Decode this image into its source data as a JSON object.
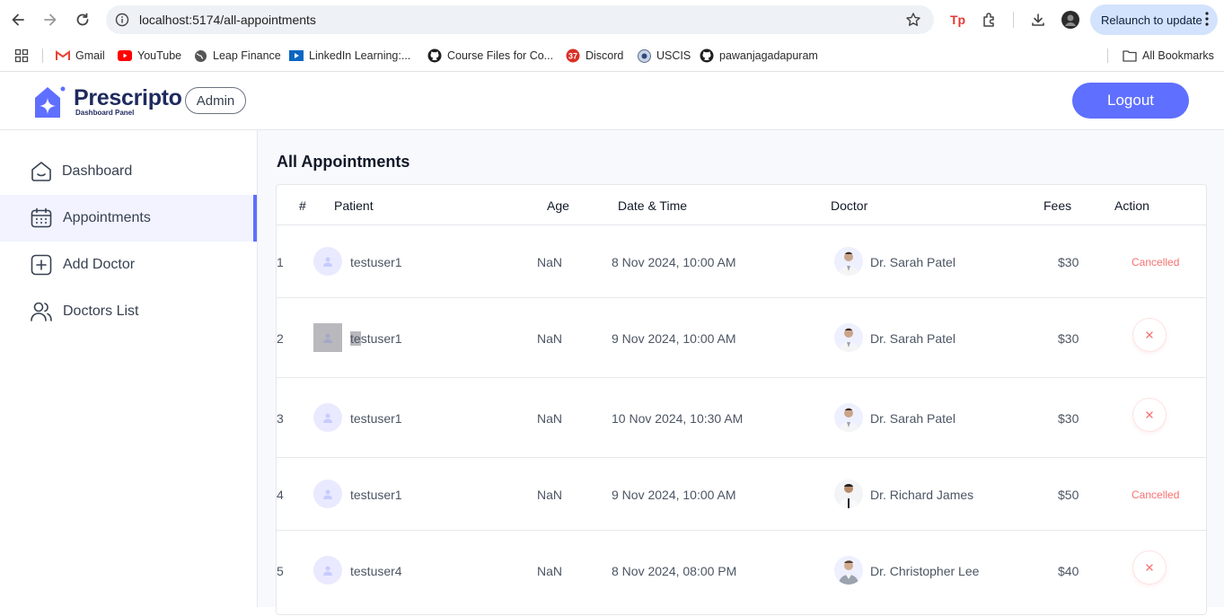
{
  "browser": {
    "url": "localhost:5174/all-appointments",
    "relaunch_label": "Relaunch to update",
    "bookmarks": [
      {
        "label": "Gmail",
        "icon": "gmail-icon"
      },
      {
        "label": "YouTube",
        "icon": "youtube-icon"
      },
      {
        "label": "Leap Finance",
        "icon": "globe-icon"
      },
      {
        "label": "LinkedIn Learning:...",
        "icon": "linkedin-learning-icon"
      },
      {
        "label": "Course Files for Co...",
        "icon": "github-icon"
      },
      {
        "label": "Discord",
        "icon": "discord-icon"
      },
      {
        "label": "USCIS",
        "icon": "uscis-icon"
      },
      {
        "label": "pawanjagadapuram",
        "icon": "github-icon"
      }
    ],
    "all_bookmarks_label": "All Bookmarks",
    "discord_badge": "37"
  },
  "header": {
    "logo_text": "Prescripto",
    "logo_subtitle": "Dashboard Panel",
    "role": "Admin",
    "logout_label": "Logout"
  },
  "sidebar": {
    "items": [
      {
        "label": "Dashboard",
        "icon": "home-icon",
        "active": false
      },
      {
        "label": "Appointments",
        "icon": "calendar-icon",
        "active": true
      },
      {
        "label": "Add Doctor",
        "icon": "add-icon",
        "active": false
      },
      {
        "label": "Doctors List",
        "icon": "people-icon",
        "active": false
      }
    ]
  },
  "main": {
    "title": "All Appointments",
    "columns": [
      "#",
      "Patient",
      "Age",
      "Date & Time",
      "Doctor",
      "Fees",
      "Action"
    ],
    "rows": [
      {
        "index": "1",
        "patient": "testuser1",
        "age": "NaN",
        "datetime": "8 Nov 2024, 10:00 AM",
        "doctor": "Dr. Sarah Patel",
        "fees": "$30",
        "action": "Cancelled"
      },
      {
        "index": "2",
        "patient": "testuser1",
        "patient_prefix": "te",
        "patient_suffix": "stuser1",
        "age": "NaN",
        "datetime": "9 Nov 2024, 10:00 AM",
        "doctor": "Dr. Sarah Patel",
        "fees": "$30",
        "action": "cancel-button"
      },
      {
        "index": "3",
        "patient": "testuser1",
        "age": "NaN",
        "datetime": "10 Nov 2024, 10:30 AM",
        "doctor": "Dr. Sarah Patel",
        "fees": "$30",
        "action": "cancel-button"
      },
      {
        "index": "4",
        "patient": "testuser1",
        "age": "NaN",
        "datetime": "9 Nov 2024, 10:00 AM",
        "doctor": "Dr. Richard James",
        "fees": "$50",
        "action": "Cancelled"
      },
      {
        "index": "5",
        "patient": "testuser4",
        "age": "NaN",
        "datetime": "8 Nov 2024, 08:00 PM",
        "doctor": "Dr. Christopher Lee",
        "fees": "$40",
        "action": "cancel-button"
      }
    ]
  },
  "colors": {
    "accent": "#5f6fff",
    "cancelled": "#f87171",
    "active_bg": "#f2f3ff"
  }
}
